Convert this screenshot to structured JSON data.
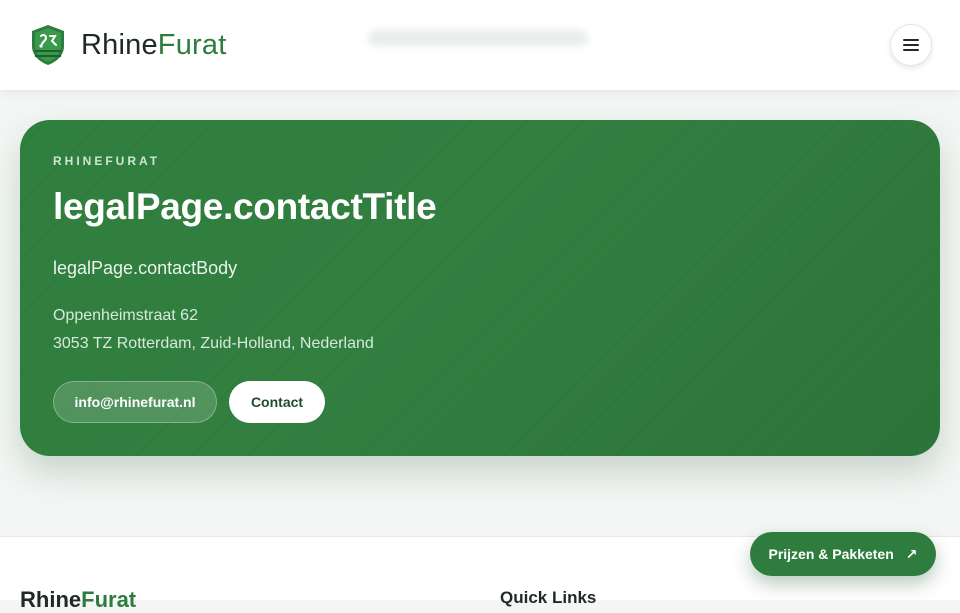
{
  "header": {
    "brand_part1": "Rhine",
    "brand_part2": "Furat",
    "logo_icon": "shield-logo-icon",
    "menu_icon": "hamburger-menu-icon"
  },
  "hero": {
    "eyebrow": "RHINEFURAT",
    "title": "legalPage.contactTitle",
    "body": "legalPage.contactBody",
    "address_line1": "Oppenheimstraat 62",
    "address_line2": "3053 TZ Rotterdam, Zuid-Holland, Nederland",
    "email_label": "info@rhinefurat.nl",
    "contact_label": "Contact"
  },
  "footer": {
    "brand_part1": "Rhine",
    "brand_part2": "Furat",
    "quick_links_heading": "Quick Links"
  },
  "fab": {
    "label": "Prijzen & Pakketen",
    "arrow": "↗"
  },
  "colors": {
    "brand_green": "#2e7d3e",
    "hero_bg": "#327f40",
    "text_dark": "#1f2a24"
  }
}
